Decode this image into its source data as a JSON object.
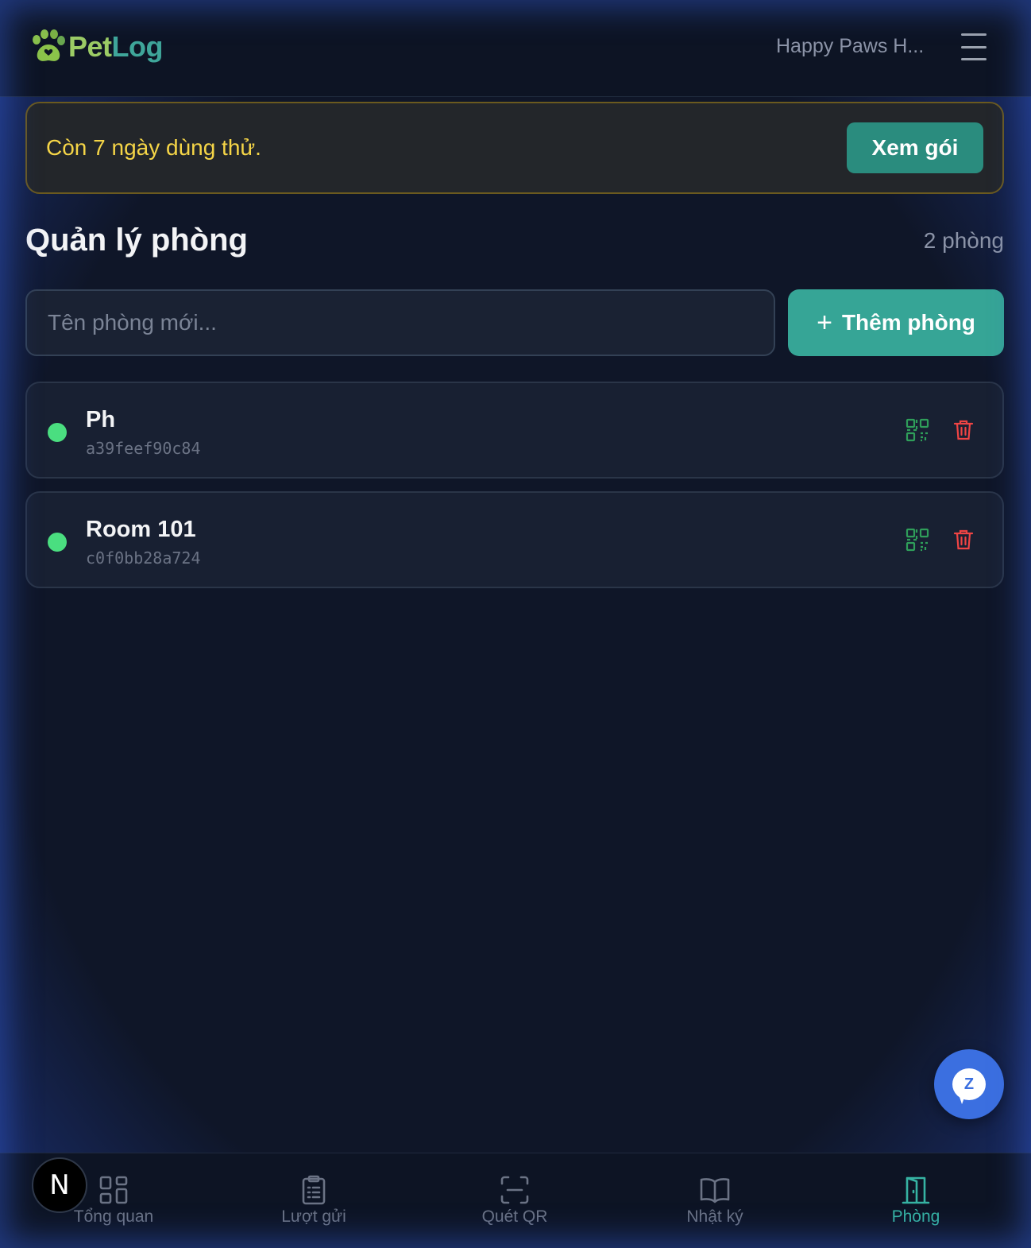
{
  "header": {
    "logo_part1": "Pet",
    "logo_part2": "Log",
    "org_name": "Happy Paws H..."
  },
  "trial_banner": {
    "text": "Còn 7 ngày dùng thử.",
    "button_label": "Xem gói"
  },
  "page": {
    "title": "Quản lý phòng",
    "room_count": "2 phòng"
  },
  "new_room": {
    "placeholder": "Tên phòng mới...",
    "add_button_label": "Thêm phòng"
  },
  "rooms": [
    {
      "name": "Ph",
      "code": "a39feef90c84",
      "status_color": "#4ade80"
    },
    {
      "name": "Room 101",
      "code": "c0f0bb28a724",
      "status_color": "#4ade80"
    }
  ],
  "bottom_nav": [
    {
      "label": "Tổng quan",
      "icon": "grid-icon"
    },
    {
      "label": "Lượt gửi",
      "icon": "clipboard-icon"
    },
    {
      "label": "Quét QR",
      "icon": "scan-icon"
    },
    {
      "label": "Nhật ký",
      "icon": "book-icon"
    },
    {
      "label": "Phòng",
      "icon": "door-icon",
      "active": true
    }
  ],
  "avatar_letter": "N",
  "chat_fab_letter": "Z",
  "colors": {
    "accent": "#36a596",
    "warning_text": "#f5d547",
    "status_online": "#4ade80",
    "danger": "#ef4444"
  }
}
